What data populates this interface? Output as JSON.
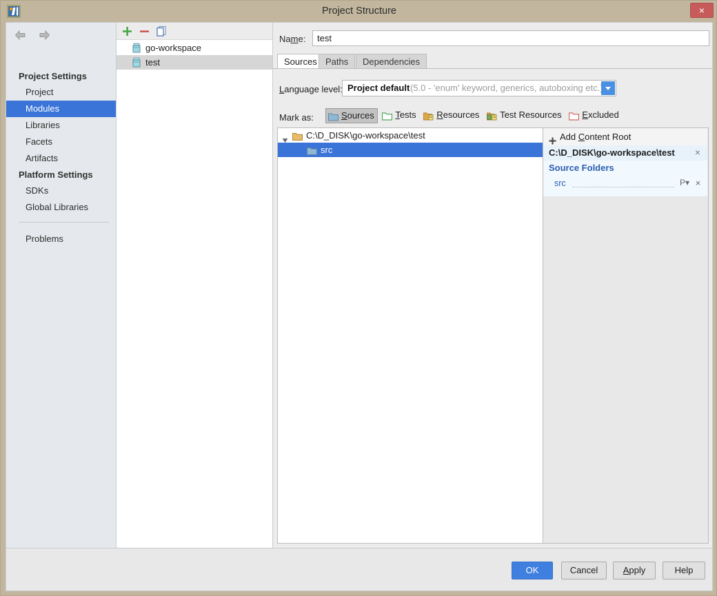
{
  "window": {
    "title": "Project Structure",
    "logo_icon": "intellij-idea-logo",
    "close_icon": "×"
  },
  "sidebar": {
    "nav": {
      "back_icon": "arrow-left-icon",
      "forward_icon": "arrow-right-icon"
    },
    "groups": [
      {
        "label": "Project Settings",
        "items": [
          {
            "label": "Project",
            "selected": false
          },
          {
            "label": "Modules",
            "selected": true
          },
          {
            "label": "Libraries",
            "selected": false
          },
          {
            "label": "Facets",
            "selected": false
          },
          {
            "label": "Artifacts",
            "selected": false
          }
        ]
      },
      {
        "label": "Platform Settings",
        "items": [
          {
            "label": "SDKs",
            "selected": false
          },
          {
            "label": "Global Libraries",
            "selected": false
          }
        ]
      }
    ],
    "problems_label": "Problems",
    "selected_color": "#3a74d8"
  },
  "modules": {
    "toolbar": {
      "add_icon": "plus-icon",
      "remove_icon": "minus-icon",
      "copy_icon": "copy-icon"
    },
    "items": [
      {
        "label": "go-workspace",
        "icon": "module-icon",
        "selected": false
      },
      {
        "label": "test",
        "icon": "module-icon",
        "selected": true
      }
    ]
  },
  "main": {
    "name_label": "Name:",
    "name_label_mnemonic": "m",
    "name_value": "test",
    "tabs": [
      {
        "label": "Sources",
        "active": true
      },
      {
        "label": "Paths",
        "active": false
      },
      {
        "label": "Dependencies",
        "active": false
      }
    ],
    "language_level": {
      "label": "Language level:",
      "value_main": "Project default",
      "value_sub": "(5.0 - 'enum' keyword, generics, autoboxing etc.)",
      "dropdown_icon": "chevron-down-icon"
    },
    "mark_as": {
      "label": "Mark as:",
      "buttons": [
        {
          "label": "Sources",
          "mnemonic": "S",
          "color": "#6e9fc4",
          "pressed": true
        },
        {
          "label": "Tests",
          "mnemonic": "T",
          "color": "#4ea85a",
          "pressed": false
        },
        {
          "label": "Resources",
          "mnemonic": "R",
          "color": "#d9a13b",
          "pressed": false
        },
        {
          "label": "Test Resources",
          "mnemonic": "",
          "color": "#d9a13b",
          "pressed": false
        },
        {
          "label": "Excluded",
          "mnemonic": "E",
          "color": "#cf6b5f",
          "pressed": false
        }
      ]
    },
    "content_tree": [
      {
        "label": "C:\\D_DISK\\go-workspace\\test",
        "folder_color": "#d9a13b",
        "expanded": true,
        "selected": false,
        "depth": 0
      },
      {
        "label": "src",
        "folder_color": "#6e9fc4",
        "expanded": false,
        "selected": true,
        "depth": 1
      }
    ],
    "detail": {
      "add_content_root": "Add Content Root",
      "add_content_root_mnemonic": "C",
      "add_icon": "plus-icon",
      "root_path": "C:\\D_DISK\\go-workspace\\test",
      "root_close_icon": "×",
      "source_folders_title": "Source Folders",
      "source_folders": [
        {
          "name": "src",
          "package_prefix_icon": "package-prefix-icon",
          "package_prefix_label": "P",
          "remove_icon": "×"
        }
      ],
      "accent_color": "#2a5db0"
    }
  },
  "footer": {
    "buttons": [
      {
        "label": "OK",
        "primary": true,
        "mnemonic": ""
      },
      {
        "label": "Cancel",
        "primary": false,
        "mnemonic": ""
      },
      {
        "label": "Apply",
        "primary": false,
        "mnemonic": "A"
      },
      {
        "label": "Help",
        "primary": false,
        "mnemonic": ""
      }
    ]
  }
}
